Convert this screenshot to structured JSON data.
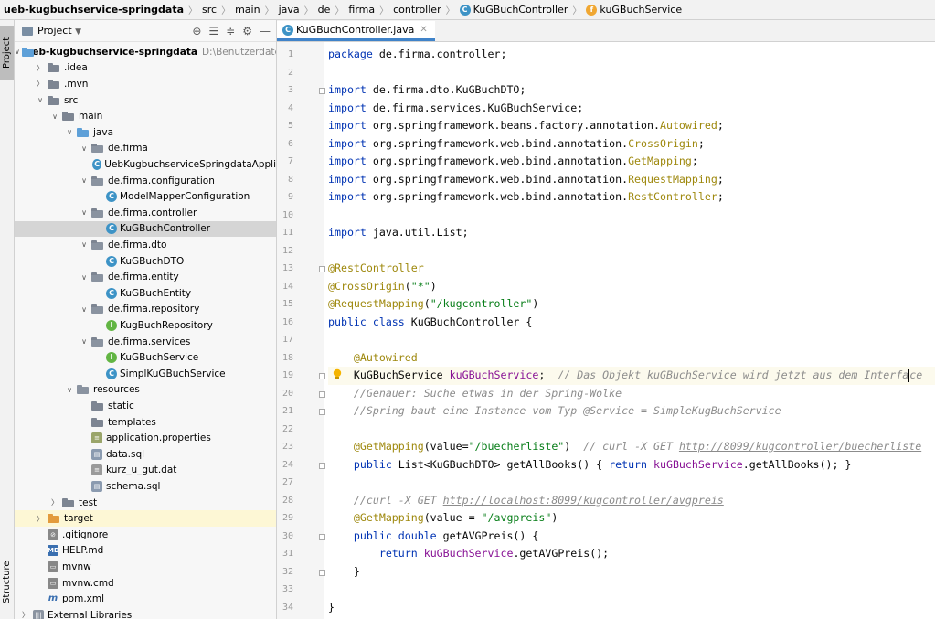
{
  "breadcrumb": {
    "items": [
      {
        "label": "ueb-kugbuchservice-springdata",
        "bold": true
      },
      {
        "label": "src"
      },
      {
        "label": "main"
      },
      {
        "label": "java"
      },
      {
        "label": "de"
      },
      {
        "label": "firma"
      },
      {
        "label": "controller"
      },
      {
        "label": "KuGBuchController",
        "icon": "C"
      },
      {
        "label": "kuGBuchService",
        "icon": "f"
      }
    ]
  },
  "side_stripe": {
    "project_tab": "Project",
    "structure_tab": "Structure"
  },
  "project_panel": {
    "title": "Project",
    "tree": [
      {
        "label": "ueb-kugbuchservice-springdata",
        "path": "D:\\Benutzerdaten\\",
        "indent": 0,
        "arrow": "down",
        "icon": "folder-blue",
        "bold": true
      },
      {
        "label": ".idea",
        "indent": 1,
        "arrow": "right",
        "icon": "folder"
      },
      {
        "label": ".mvn",
        "indent": 1,
        "arrow": "right",
        "icon": "folder"
      },
      {
        "label": "src",
        "indent": 1,
        "arrow": "down",
        "icon": "folder"
      },
      {
        "label": "main",
        "indent": 2,
        "arrow": "down",
        "icon": "folder"
      },
      {
        "label": "java",
        "indent": 3,
        "arrow": "down",
        "icon": "folder-blue"
      },
      {
        "label": "de.firma",
        "indent": 4,
        "arrow": "down",
        "icon": "package"
      },
      {
        "label": "UebKugbuchserviceSpringdataAppli",
        "indent": 5,
        "icon": "spring-class"
      },
      {
        "label": "de.firma.configuration",
        "indent": 4,
        "arrow": "down",
        "icon": "package"
      },
      {
        "label": "ModelMapperConfiguration",
        "indent": 5,
        "icon": "class"
      },
      {
        "label": "de.firma.controller",
        "indent": 4,
        "arrow": "down",
        "icon": "package"
      },
      {
        "label": "KuGBuchController",
        "indent": 5,
        "icon": "class",
        "selected": true
      },
      {
        "label": "de.firma.dto",
        "indent": 4,
        "arrow": "down",
        "icon": "package"
      },
      {
        "label": "KuGBuchDTO",
        "indent": 5,
        "icon": "class"
      },
      {
        "label": "de.firma.entity",
        "indent": 4,
        "arrow": "down",
        "icon": "package"
      },
      {
        "label": "KuGBuchEntity",
        "indent": 5,
        "icon": "class"
      },
      {
        "label": "de.firma.repository",
        "indent": 4,
        "arrow": "down",
        "icon": "package"
      },
      {
        "label": "KugBuchRepository",
        "indent": 5,
        "icon": "interface"
      },
      {
        "label": "de.firma.services",
        "indent": 4,
        "arrow": "down",
        "icon": "package"
      },
      {
        "label": "KuGBuchService",
        "indent": 5,
        "icon": "interface"
      },
      {
        "label": "SimplKuGBuchService",
        "indent": 5,
        "icon": "class"
      },
      {
        "label": "resources",
        "indent": 3,
        "arrow": "down",
        "icon": "folder-res"
      },
      {
        "label": "static",
        "indent": 4,
        "icon": "folder"
      },
      {
        "label": "templates",
        "indent": 4,
        "icon": "folder"
      },
      {
        "label": "application.properties",
        "indent": 4,
        "icon": "props"
      },
      {
        "label": "data.sql",
        "indent": 4,
        "icon": "sql"
      },
      {
        "label": "kurz_u_gut.dat",
        "indent": 4,
        "icon": "dat"
      },
      {
        "label": "schema.sql",
        "indent": 4,
        "icon": "sql"
      },
      {
        "label": "test",
        "indent": 2,
        "arrow": "right",
        "icon": "folder"
      },
      {
        "label": "target",
        "indent": 1,
        "arrow": "right",
        "icon": "folder-orange",
        "highlight": true
      },
      {
        "label": ".gitignore",
        "indent": 1,
        "icon": "git"
      },
      {
        "label": "HELP.md",
        "indent": 1,
        "icon": "md"
      },
      {
        "label": "mvnw",
        "indent": 1,
        "icon": "mvnw"
      },
      {
        "label": "mvnw.cmd",
        "indent": 1,
        "icon": "mvnw"
      },
      {
        "label": "pom.xml",
        "indent": 1,
        "icon": "pom"
      },
      {
        "label": "External Libraries",
        "indent": 0,
        "arrow": "right",
        "icon": "lib"
      }
    ]
  },
  "editor": {
    "tab_label": "KuGBuchController.java",
    "cursor_line": 19,
    "lines": [
      [
        {
          "t": "package ",
          "c": "kw"
        },
        {
          "t": "de.firma.controller;"
        }
      ],
      [],
      [
        {
          "t": "import ",
          "c": "kw"
        },
        {
          "t": "de.firma.dto.KuGBuchDTO;"
        }
      ],
      [
        {
          "t": "import ",
          "c": "kw"
        },
        {
          "t": "de.firma.services.KuGBuchService;"
        }
      ],
      [
        {
          "t": "import ",
          "c": "kw"
        },
        {
          "t": "org.springframework.beans.factory.annotation."
        },
        {
          "t": "Autowired",
          "c": "an"
        },
        {
          "t": ";"
        }
      ],
      [
        {
          "t": "import ",
          "c": "kw"
        },
        {
          "t": "org.springframework.web.bind.annotation."
        },
        {
          "t": "CrossOrigin",
          "c": "an"
        },
        {
          "t": ";"
        }
      ],
      [
        {
          "t": "import ",
          "c": "kw"
        },
        {
          "t": "org.springframework.web.bind.annotation."
        },
        {
          "t": "GetMapping",
          "c": "an"
        },
        {
          "t": ";"
        }
      ],
      [
        {
          "t": "import ",
          "c": "kw"
        },
        {
          "t": "org.springframework.web.bind.annotation."
        },
        {
          "t": "RequestMapping",
          "c": "an"
        },
        {
          "t": ";"
        }
      ],
      [
        {
          "t": "import ",
          "c": "kw"
        },
        {
          "t": "org.springframework.web.bind.annotation."
        },
        {
          "t": "RestController",
          "c": "an"
        },
        {
          "t": ";"
        }
      ],
      [],
      [
        {
          "t": "import ",
          "c": "kw"
        },
        {
          "t": "java.util.List;"
        }
      ],
      [],
      [
        {
          "t": "@RestController",
          "c": "an"
        }
      ],
      [
        {
          "t": "@CrossOrigin",
          "c": "an"
        },
        {
          "t": "("
        },
        {
          "t": "\"*\"",
          "c": "st"
        },
        {
          "t": ")"
        }
      ],
      [
        {
          "t": "@RequestMapping",
          "c": "an"
        },
        {
          "t": "("
        },
        {
          "t": "\"/kugcontroller\"",
          "c": "st"
        },
        {
          "t": ")"
        }
      ],
      [
        {
          "t": "public class ",
          "c": "kw"
        },
        {
          "t": "KuGBuchController {"
        }
      ],
      [],
      [
        {
          "t": "    "
        },
        {
          "t": "@Autowired",
          "c": "an"
        }
      ],
      [
        {
          "t": "    KuGBuchService "
        },
        {
          "t": "kuGBuchService",
          "c": "fd"
        },
        {
          "t": ";  "
        },
        {
          "t": "// Das Objekt kuGBuchService wird jetzt aus dem Interfa",
          "c": "cm"
        },
        {
          "t": "",
          "c": "caret"
        },
        {
          "t": "ce",
          "c": "cm"
        }
      ],
      [
        {
          "t": "    "
        },
        {
          "t": "//Genauer: Suche etwas in der Spring-Wolke",
          "c": "cm"
        }
      ],
      [
        {
          "t": "    "
        },
        {
          "t": "//Spring baut eine Instance vom Typ @Service = SimpleKugBuchService",
          "c": "cm"
        }
      ],
      [],
      [
        {
          "t": "    "
        },
        {
          "t": "@GetMapping",
          "c": "an"
        },
        {
          "t": "(value="
        },
        {
          "t": "\"/buecherliste\"",
          "c": "st"
        },
        {
          "t": ")  "
        },
        {
          "t": "// curl -X GET ",
          "c": "cm"
        },
        {
          "t": "http://8099/kugcontroller/buecherliste",
          "c": "cm ul"
        }
      ],
      [
        {
          "t": "    "
        },
        {
          "t": "public ",
          "c": "kw"
        },
        {
          "t": "List<KuGBuchDTO> getAllBooks() { "
        },
        {
          "t": "return ",
          "c": "kw"
        },
        {
          "t": "kuGBuchService",
          "c": "fd"
        },
        {
          "t": ".getAllBooks(); }"
        }
      ],
      [],
      [
        {
          "t": "    "
        },
        {
          "t": "//curl -X GET ",
          "c": "cm"
        },
        {
          "t": "http://localhost:8099/kugcontroller/avgpreis",
          "c": "cm ul"
        }
      ],
      [
        {
          "t": "    "
        },
        {
          "t": "@GetMapping",
          "c": "an"
        },
        {
          "t": "(value = "
        },
        {
          "t": "\"/avgpreis\"",
          "c": "st"
        },
        {
          "t": ")"
        }
      ],
      [
        {
          "t": "    "
        },
        {
          "t": "public double ",
          "c": "kw"
        },
        {
          "t": "getAVGPreis() {"
        }
      ],
      [
        {
          "t": "        "
        },
        {
          "t": "return ",
          "c": "kw"
        },
        {
          "t": "kuGBuchService",
          "c": "fd"
        },
        {
          "t": ".getAVGPreis();"
        }
      ],
      [
        {
          "t": "    }"
        }
      ],
      [],
      [
        {
          "t": "}"
        }
      ]
    ],
    "line_numbers": [
      "1",
      "2",
      "3",
      "4",
      "5",
      "6",
      "7",
      "8",
      "9",
      "10",
      "11",
      "12",
      "13",
      "14",
      "15",
      "16",
      "17",
      "18",
      "19",
      "20",
      "21",
      "22",
      "23",
      "24",
      "27",
      "28",
      "29",
      "30",
      "31",
      "32",
      "33",
      "34"
    ]
  },
  "colors": {
    "accent": "#4083c9",
    "selection": "#d5d5d5",
    "keyword": "#0033b3",
    "annotation": "#9e880d",
    "string": "#067d17",
    "comment": "#8c8c8c",
    "field": "#871094"
  }
}
